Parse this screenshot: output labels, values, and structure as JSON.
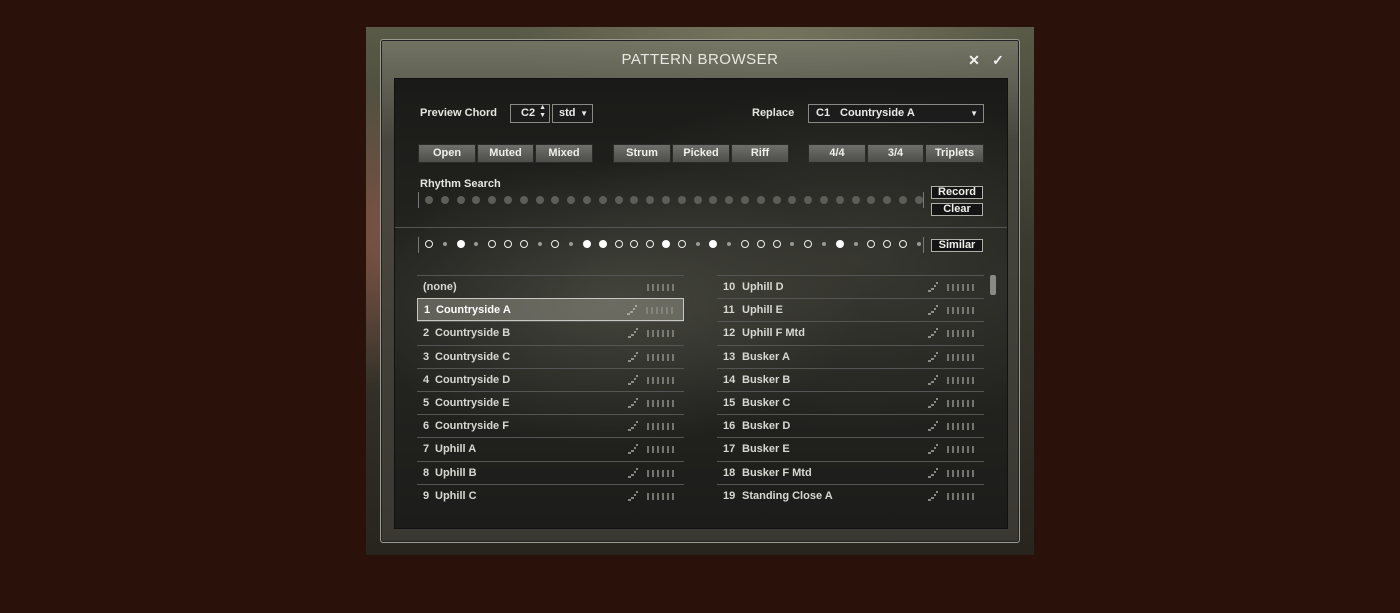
{
  "window": {
    "title": "PATTERN BROWSER",
    "close_icon": "✕",
    "ok_icon": "✓"
  },
  "preview": {
    "label": "Preview Chord",
    "chord": "C2",
    "type": "std"
  },
  "replace": {
    "label": "Replace",
    "slot": "C1",
    "pattern": "Countryside A"
  },
  "filters": {
    "mute": [
      "Open",
      "Muted",
      "Mixed"
    ],
    "style": [
      "Strum",
      "Picked",
      "Riff"
    ],
    "meter": [
      "4/4",
      "3/4",
      "Triplets"
    ]
  },
  "rhythm_search": {
    "label": "Rhythm Search",
    "record": "Record",
    "clear": "Clear",
    "similar": "Similar"
  },
  "pattern_row": [
    "o",
    "s",
    "f",
    "s",
    "o",
    "o",
    "o",
    "s",
    "o",
    "s",
    "f",
    "f",
    "o",
    "o",
    "o",
    "f",
    "o",
    "s",
    "f",
    "s",
    "o",
    "o",
    "o",
    "s",
    "o",
    "s",
    "f",
    "s",
    "o",
    "o",
    "o",
    "s"
  ],
  "patterns_left": [
    {
      "num": "",
      "name": "(none)",
      "selected": false
    },
    {
      "num": "1",
      "name": "Countryside A",
      "selected": true
    },
    {
      "num": "2",
      "name": "Countryside B",
      "selected": false
    },
    {
      "num": "3",
      "name": "Countryside C",
      "selected": false
    },
    {
      "num": "4",
      "name": "Countryside D",
      "selected": false
    },
    {
      "num": "5",
      "name": "Countryside E",
      "selected": false
    },
    {
      "num": "6",
      "name": "Countryside F",
      "selected": false
    },
    {
      "num": "7",
      "name": "Uphill A",
      "selected": false
    },
    {
      "num": "8",
      "name": "Uphill B",
      "selected": false
    },
    {
      "num": "9",
      "name": "Uphill C",
      "selected": false
    }
  ],
  "patterns_right": [
    {
      "num": "10",
      "name": "Uphill D"
    },
    {
      "num": "11",
      "name": "Uphill E"
    },
    {
      "num": "12",
      "name": "Uphill F Mtd"
    },
    {
      "num": "13",
      "name": "Busker A"
    },
    {
      "num": "14",
      "name": "Busker B"
    },
    {
      "num": "15",
      "name": "Busker C"
    },
    {
      "num": "16",
      "name": "Busker D"
    },
    {
      "num": "17",
      "name": "Busker E"
    },
    {
      "num": "18",
      "name": "Busker F Mtd"
    },
    {
      "num": "19",
      "name": "Standing Close A"
    }
  ]
}
